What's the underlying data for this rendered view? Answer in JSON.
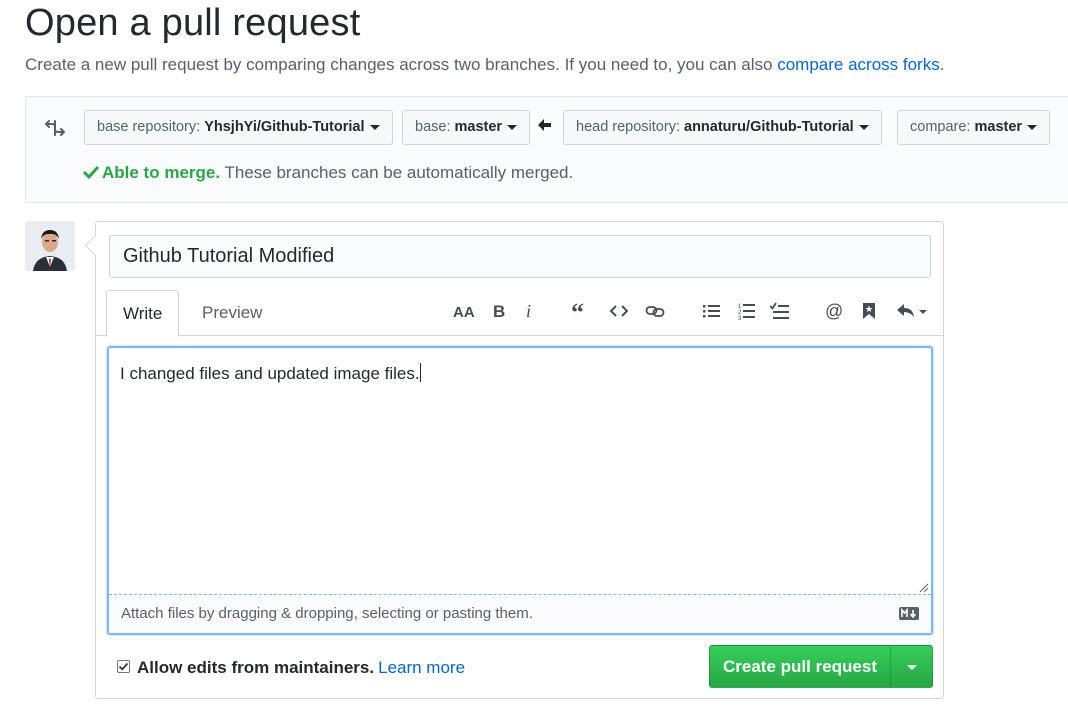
{
  "page": {
    "title": "Open a pull request",
    "subtitle_text": "Create a new pull request by comparing changes across two branches. If you need to, you can also ",
    "subtitle_link": "compare across forks",
    "subtitle_end": "."
  },
  "range": {
    "base_repo_label": "base repository: ",
    "base_repo_value": "YhsjhYi/Github-Tutorial",
    "base_label": "base: ",
    "base_value": "master",
    "head_repo_label": "head repository: ",
    "head_repo_value": "annaturu/Github-Tutorial",
    "compare_label": "compare: ",
    "compare_value": "master",
    "merge_ok": "Able to merge.",
    "merge_text": " These branches can be automatically merged."
  },
  "form": {
    "title_value": "Github Tutorial Modified",
    "tabs": [
      "Write",
      "Preview"
    ],
    "body_value": "I changed files and updated  image files.",
    "attach_hint": "Attach files by dragging & dropping, selecting or pasting them.",
    "toolbar_icons": [
      "text-size-icon",
      "bold-icon",
      "italic-icon",
      "quote-icon",
      "code-icon",
      "link-icon",
      "bullet-list-icon",
      "numbered-list-icon",
      "task-list-icon",
      "mention-icon",
      "saved-reply-icon",
      "reply-icon"
    ],
    "allow_edits_label": "Allow edits from maintainers.",
    "allow_edits_checked": true,
    "learn_more": "Learn more",
    "create_button": "Create pull request"
  },
  "colors": {
    "link": "#0366d6",
    "success": "#28a745",
    "focus": "#79b8ff"
  }
}
